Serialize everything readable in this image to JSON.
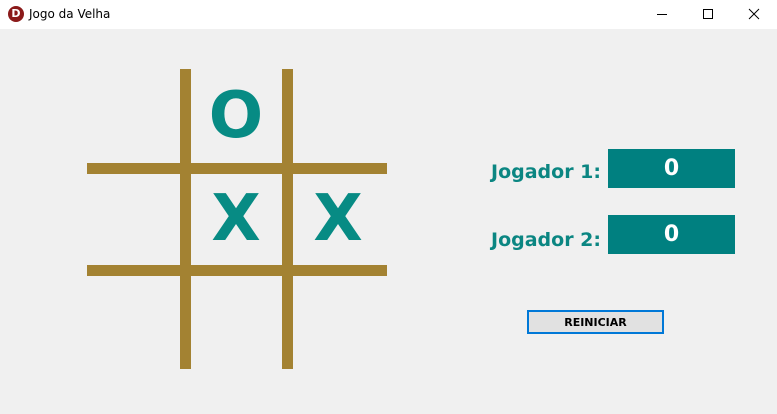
{
  "window": {
    "title": "Jogo da Velha",
    "icon_letter": "D",
    "icon_name": "app-icon",
    "controls": [
      "minimize-icon",
      "maximize-icon",
      "close-icon"
    ]
  },
  "board": {
    "cells": [
      "",
      "O",
      "",
      "",
      "X",
      "X",
      "",
      "",
      ""
    ],
    "line_color": "#a38232",
    "mark_color": "#078b84"
  },
  "scoreboard": {
    "player1_label": "Jogador 1:",
    "player1_score": "0",
    "player2_label": "Jogador 2:",
    "player2_score": "0",
    "label_color": "#0b8682",
    "box_color": "#008080"
  },
  "controls": {
    "reset_label": "REINICIAR"
  }
}
